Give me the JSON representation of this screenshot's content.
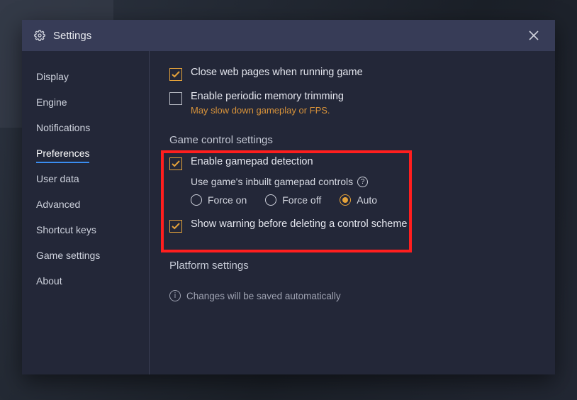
{
  "window": {
    "title": "Settings"
  },
  "sidebar": {
    "items": [
      {
        "label": "Display"
      },
      {
        "label": "Engine"
      },
      {
        "label": "Notifications"
      },
      {
        "label": "Preferences",
        "active": true
      },
      {
        "label": "User data"
      },
      {
        "label": "Advanced"
      },
      {
        "label": "Shortcut keys"
      },
      {
        "label": "Game settings"
      },
      {
        "label": "About"
      }
    ]
  },
  "content": {
    "close_web": {
      "label": "Close web pages when running game",
      "checked": true
    },
    "mem_trim": {
      "label": "Enable periodic memory trimming",
      "hint": "May slow down gameplay or FPS.",
      "checked": false
    },
    "section_game_controls": "Game control settings",
    "gamepad_detect": {
      "label": "Enable gamepad detection",
      "checked": true
    },
    "gamepad_inbuilt": {
      "label": "Use game's inbuilt gamepad controls",
      "options": {
        "force_on": "Force on",
        "force_off": "Force off",
        "auto": "Auto"
      },
      "selected": "auto"
    },
    "delete_warn": {
      "label": "Show warning before deleting a control scheme",
      "checked": true
    },
    "section_platform": "Platform settings",
    "footer": "Changes will be saved automatically"
  },
  "colors": {
    "accent": "#e4a23a",
    "link": "#3a8df0",
    "highlight": "#ff1e1e"
  }
}
